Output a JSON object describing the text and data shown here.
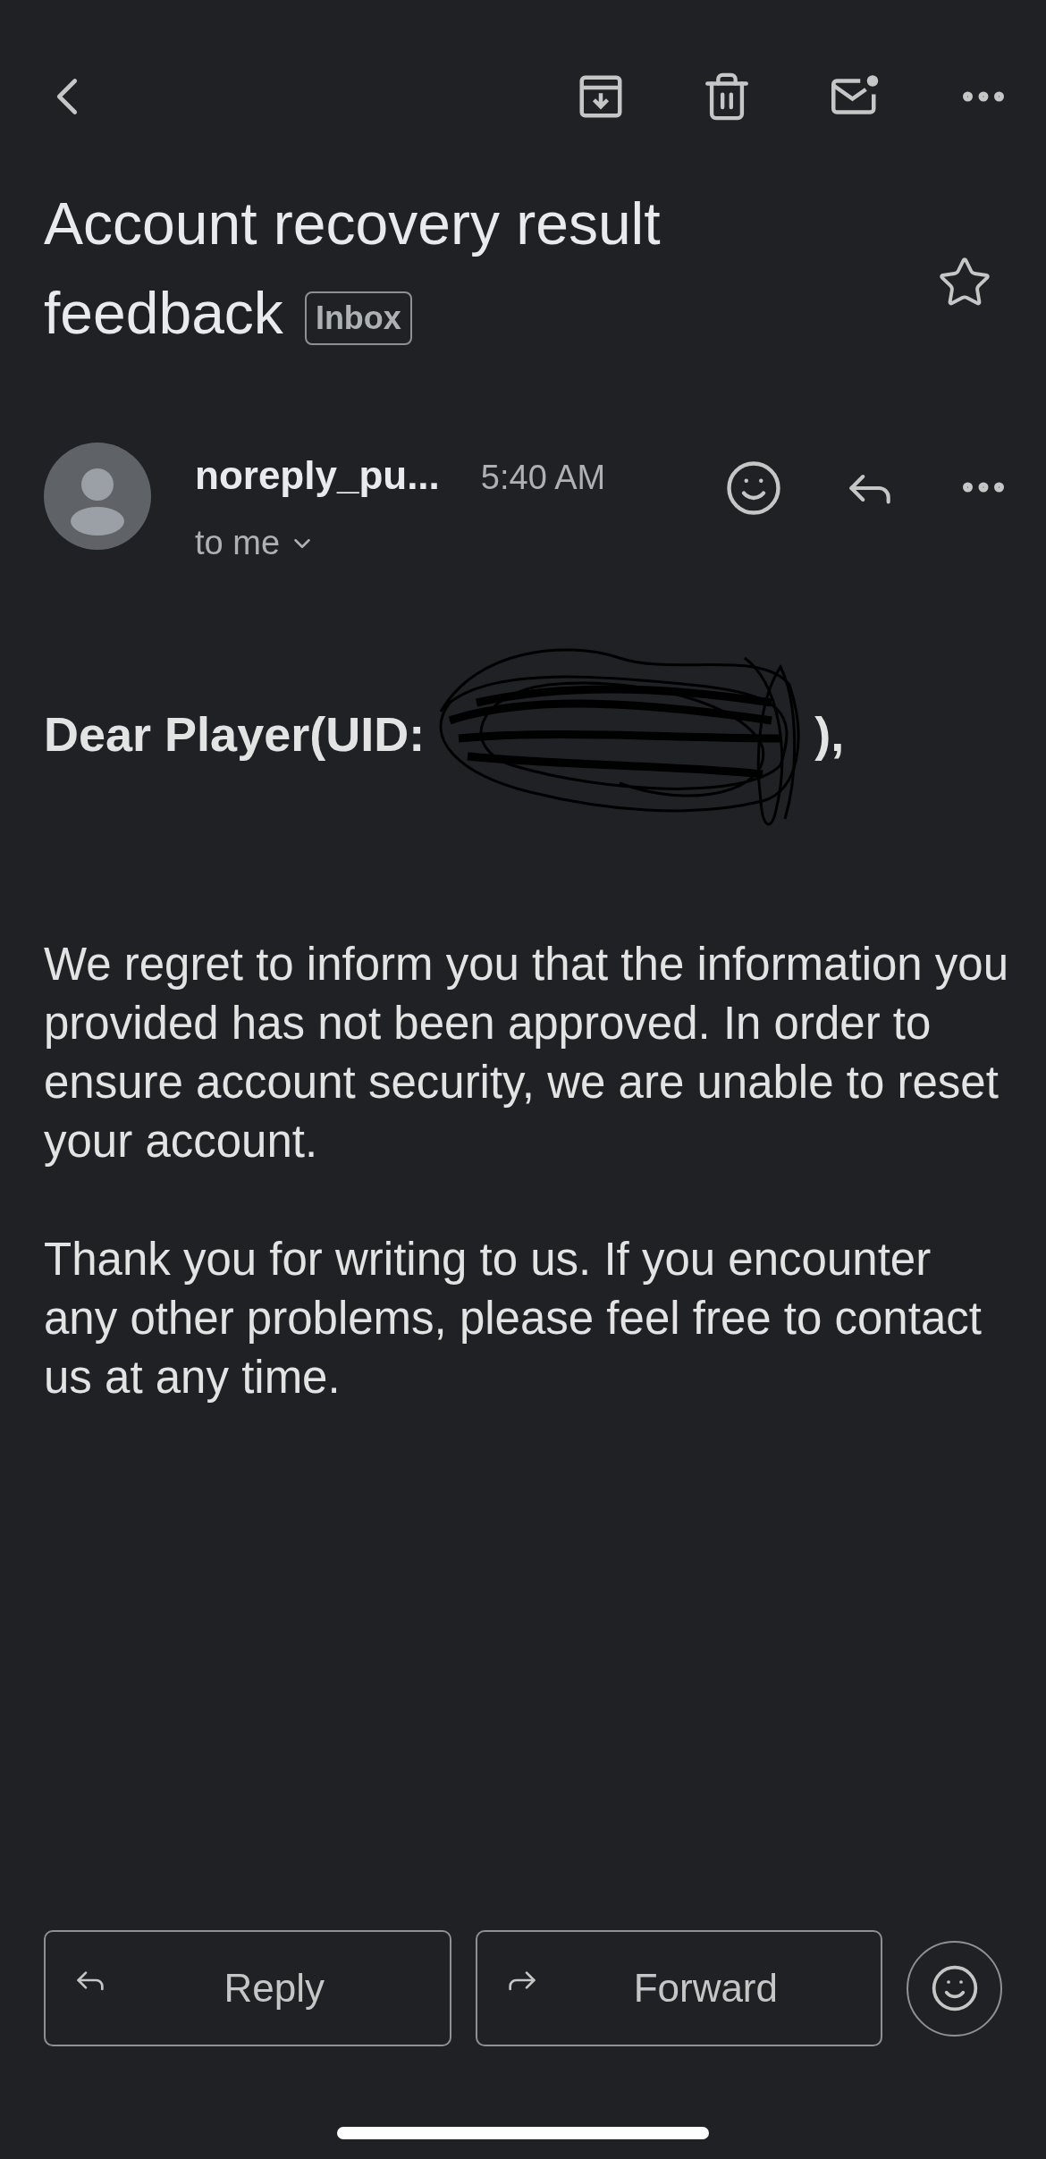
{
  "subject": {
    "title_lines": [
      "Account recovery result",
      "feedback"
    ],
    "label": "Inbox",
    "starred": false
  },
  "message": {
    "sender": "noreply_pu...",
    "time": "5:40 AM",
    "recipient": "to me"
  },
  "body": {
    "greeting_start": "Dear Player(UID:",
    "greeting_end": "),",
    "paragraphs": [
      "We regret to inform you that the information you provided has not been approved. In order to ensure account security, we are unable to reset your account.",
      "Thank you for writing to us. If you encounter any other problems, please feel free to contact us at any time."
    ]
  },
  "actions": [
    {
      "kind": "reply",
      "label": "Reply"
    },
    {
      "kind": "forward",
      "label": "Forward"
    }
  ]
}
